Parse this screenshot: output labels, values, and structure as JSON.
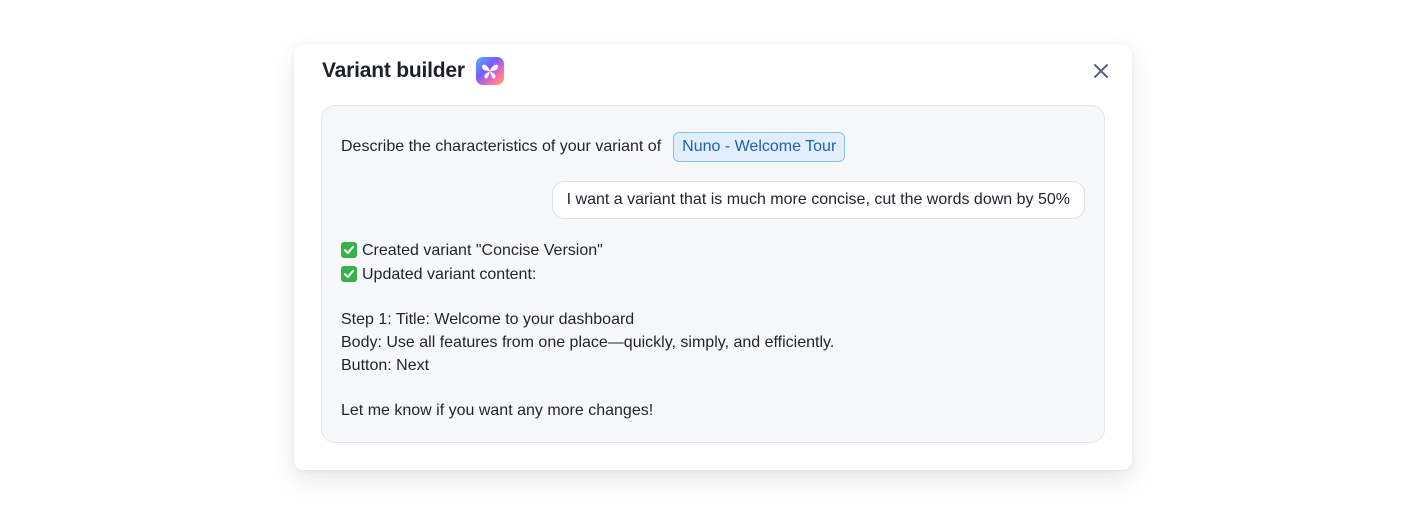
{
  "modal": {
    "title": "Variant builder",
    "logo_icon": "butterfly-logo-icon",
    "close_icon": "close-icon"
  },
  "conversation": {
    "assistant_prompt": "Describe the characteristics of your variant of",
    "flow_chip": "Nuno - Welcome Tour",
    "user_message": "I want a variant that is much more concise, cut the words down by 50%",
    "reply": {
      "status_lines": [
        "Created variant \"Concise Version\"",
        "Updated variant content:"
      ],
      "step_title": "Step 1: Title: Welcome to your dashboard",
      "step_body": "Body: Use all features from one place—quickly, simply, and efficiently.",
      "step_button": "Button: Next",
      "closing": "Let me know if you want any more changes!"
    }
  },
  "colors": {
    "chip_bg": "#e1effd",
    "chip_border": "#8cc0f2",
    "chip_text": "#1d5fb0",
    "check_green": "#37b24d"
  }
}
